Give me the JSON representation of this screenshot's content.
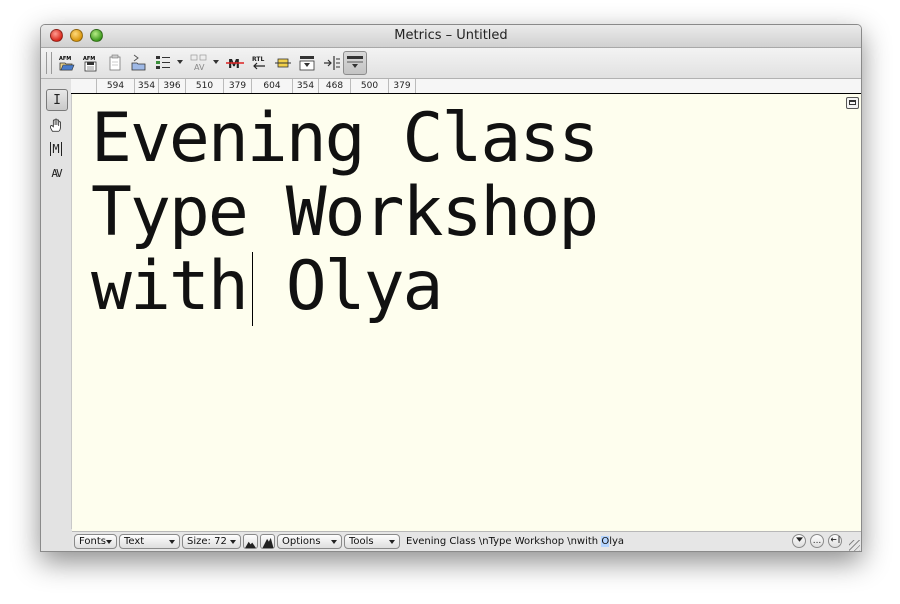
{
  "window": {
    "title": "Metrics – Untitled"
  },
  "toolbar": {
    "buttons": [
      {
        "icon": "afm-open-icon"
      },
      {
        "icon": "afm-save-icon"
      },
      {
        "icon": "paste-metrics-icon"
      },
      {
        "icon": "open-file-icon"
      },
      {
        "icon": "list-icon"
      },
      {
        "icon": "kerning-av-icon"
      },
      {
        "icon": "strike-m-icon"
      },
      {
        "icon": "rtl-icon"
      },
      {
        "icon": "baseline-icon"
      },
      {
        "icon": "show-metrics-icon"
      },
      {
        "icon": "indent-icon"
      },
      {
        "icon": "options-panel-icon"
      }
    ],
    "afm_label": "AFM",
    "rtl_label": "RTL"
  },
  "ruler": {
    "values": [
      "594",
      "354",
      "396",
      "510",
      "379",
      "604",
      "354",
      "468",
      "500",
      "379"
    ]
  },
  "palette": {
    "text_tool": "I",
    "metrics_tool": "M",
    "kern_tool": "AV"
  },
  "sample": {
    "lines": [
      "Evening Class",
      "Type Workshop",
      "with Olya"
    ]
  },
  "status": {
    "fonts_label": "Fonts",
    "text_label": "Text",
    "size_label": "Size: 72",
    "options_label": "Options",
    "tools_label": "Tools",
    "text_prefix": "Evening Class \\nType Workshop \\nwith ",
    "text_selected": "O",
    "text_suffix": "lya",
    "more_label": "..."
  }
}
